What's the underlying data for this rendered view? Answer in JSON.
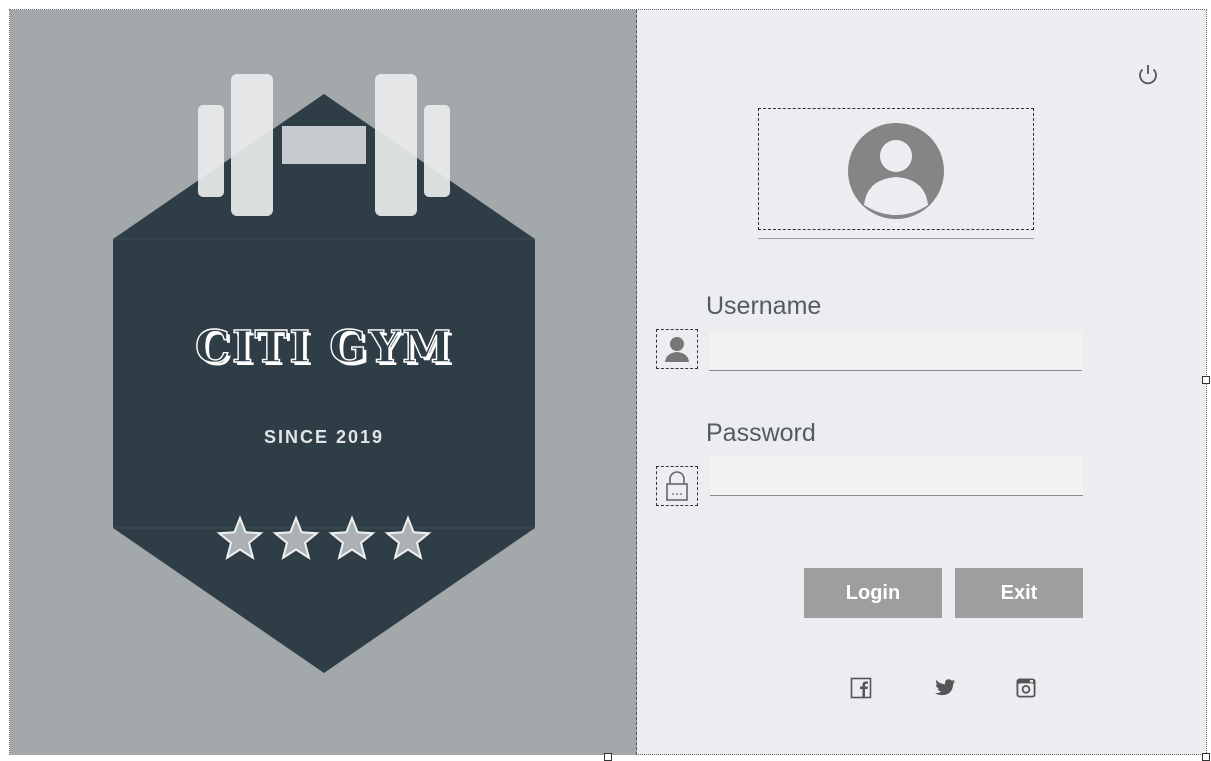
{
  "brand": {
    "name": "CITI GYM",
    "tagline": "SINCE 2019",
    "star_count": 4
  },
  "form": {
    "username_label": "Username",
    "username_value": "",
    "password_label": "Password",
    "password_value": ""
  },
  "buttons": {
    "login": "Login",
    "exit": "Exit"
  },
  "icons": {
    "power": "power-icon",
    "avatar": "user-avatar-icon",
    "user": "user-icon",
    "lock": "lock-icon",
    "facebook": "facebook-icon",
    "twitter": "twitter-icon",
    "instagram": "instagram-icon"
  },
  "colors": {
    "left_panel": "#a3a9aa",
    "badge": "#2f3d47",
    "right_panel": "#ecedf1",
    "button": "#9e9e9e",
    "icon": "#666666"
  }
}
